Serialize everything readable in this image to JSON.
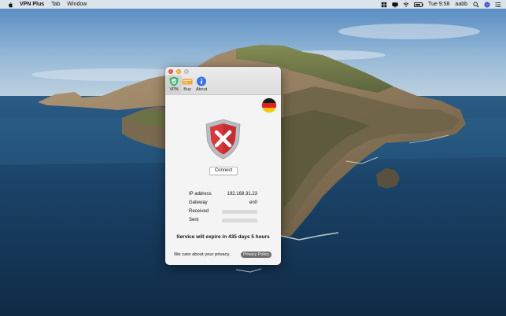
{
  "menubar": {
    "app_name": "VPN Plus",
    "menus": [
      "Tab",
      "Window"
    ],
    "status_icons": [
      "grid-icon",
      "display-icon",
      "wifi-icon",
      "battery-icon"
    ],
    "battery_percent": 80,
    "clock": "Tue 9:58",
    "user": "aabb",
    "right_icons": [
      "search-icon",
      "siri-icon",
      "notification-center-icon"
    ]
  },
  "toolbar": {
    "items": [
      {
        "label": "VPN",
        "icon": "vpn-shield-icon",
        "selected": true
      },
      {
        "label": "Buy",
        "icon": "buy-ticket-icon",
        "selected": false
      },
      {
        "label": "About",
        "icon": "info-icon",
        "selected": false
      }
    ]
  },
  "status": {
    "country": "germany-flag-icon",
    "shield_icon": "disconnected-shield-icon",
    "connect_label": "Connect"
  },
  "details": {
    "ip_label": "IP address",
    "ip_value": "192.168.31.23",
    "gateway_label": "Gateway",
    "gateway_value": "en0",
    "received_label": "Received",
    "sent_label": "Sent"
  },
  "expiry": "Service will expire in 435 days 5 hours",
  "privacy": {
    "text": "We care about your privacy.",
    "button_label": "Privacy Policy"
  },
  "colors": {
    "close": "#fc605b",
    "minimize": "#fdbc40",
    "shield_red": "#d9383a",
    "shield_silver": "#b9bcc0",
    "vpn_green": "#3cb36b",
    "about_blue": "#3a74e0",
    "buy_orange": "#f0a43b"
  }
}
